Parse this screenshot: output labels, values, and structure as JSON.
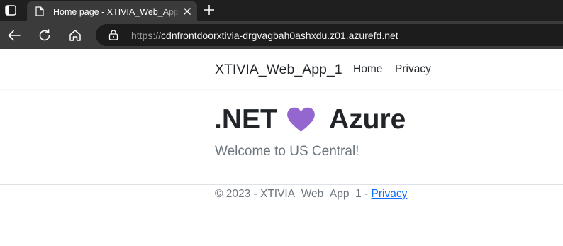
{
  "browser": {
    "tab": {
      "title": "Home page - XTIVIA_Web_App_1"
    },
    "address": {
      "scheme": "https://",
      "host": "cdnfrontdoorxtivia-drgvagbah0ashxdu.z01.azurefd.net"
    }
  },
  "header": {
    "brand": "XTIVIA_Web_App_1",
    "nav": [
      {
        "label": "Home"
      },
      {
        "label": "Privacy"
      }
    ]
  },
  "main": {
    "heading_left": ".NET",
    "heading_icon": "heart-icon",
    "heading_right": "Azure",
    "heart_color": "#9467d0",
    "subtitle": "Welcome to US Central!"
  },
  "footer": {
    "text": "© 2023 - XTIVIA_Web_App_1 - ",
    "link": "Privacy"
  }
}
